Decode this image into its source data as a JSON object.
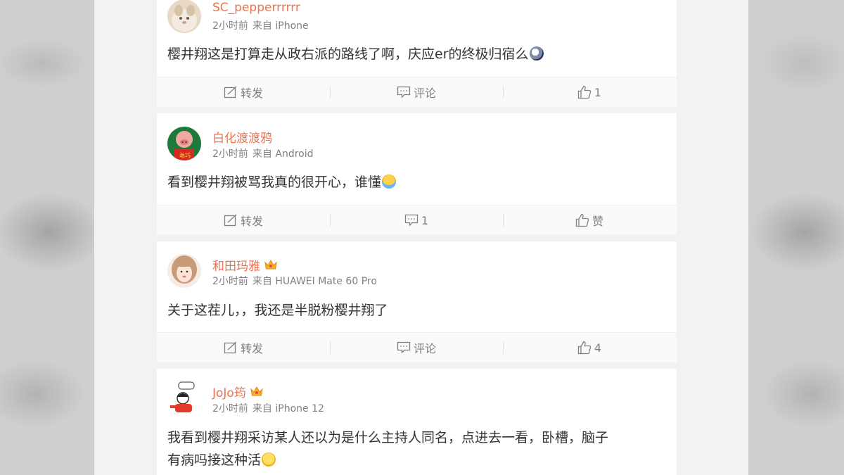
{
  "posts": [
    {
      "username": "SC_pepperrrrrr",
      "time": "2小时前",
      "source": "来自 iPhone",
      "text": "樱井翔这是打算走从政右派的路线了啊，庆应er的终极归宿么",
      "text2": "",
      "has_crown": false,
      "emoji": "thinking-emoji",
      "repost_label": "转发",
      "comment_label": "评论",
      "like_label": "1"
    },
    {
      "username": "白化渡渡鸦",
      "time": "2小时前",
      "source": "来自 Android",
      "text": "看到樱井翔被骂我真的很开心，谁懂",
      "text2": "",
      "has_crown": false,
      "emoji": "crying-emoji",
      "repost_label": "转发",
      "comment_label": "1",
      "like_label": "赞"
    },
    {
      "username": "和田玛雅",
      "time": "2小时前",
      "source": "来自 HUAWEI Mate 60 Pro",
      "text": "关于这茬儿，，我还是半脱粉樱井翔了",
      "text2": "",
      "has_crown": true,
      "emoji": "",
      "repost_label": "转发",
      "comment_label": "评论",
      "like_label": "4"
    },
    {
      "username": "JoJo筠",
      "time": "2小时前",
      "source": "来自 iPhone 12",
      "text": "我看到樱井翔采访某人还以为是什么主持人同名，点进去一看，卧槽，脑子",
      "text2": "有病吗接这种活",
      "has_crown": true,
      "emoji": "shocked-emoji",
      "repost_label": "",
      "comment_label": "",
      "like_label": ""
    }
  ],
  "colors": {
    "username": "#eb7350",
    "meta": "#808080",
    "text": "#333333",
    "background": "#f2f2f2"
  }
}
